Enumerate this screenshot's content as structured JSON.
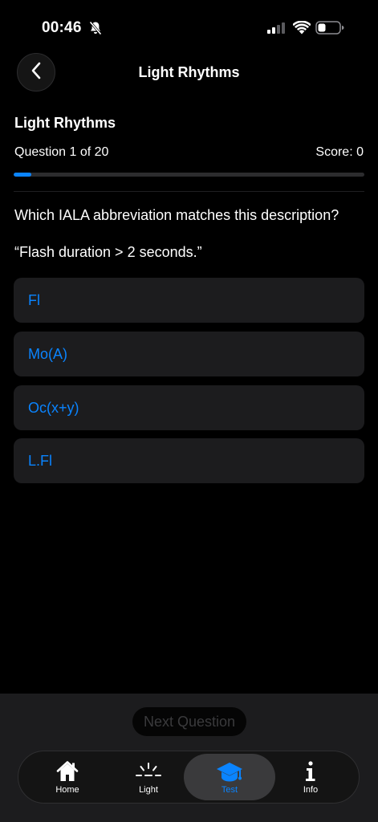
{
  "status": {
    "time": "00:46"
  },
  "nav": {
    "title": "Light Rhythms"
  },
  "quiz": {
    "title": "Light Rhythms",
    "progress_text": "Question 1 of 20",
    "score_text": "Score: 0",
    "progress_fraction": 0.05,
    "question": "Which IALA abbreviation matches this description?",
    "description": "“Flash duration > 2 seconds.”",
    "options": [
      "Fl",
      "Mo(A)",
      "Oc(x+y)",
      "L.Fl"
    ]
  },
  "next_button": {
    "label": "Next Question"
  },
  "tabs": [
    {
      "label": "Home",
      "icon": "house-icon",
      "active": false
    },
    {
      "label": "Light",
      "icon": "light-rays-icon",
      "active": false
    },
    {
      "label": "Test",
      "icon": "graduation-cap-icon",
      "active": true
    },
    {
      "label": "Info",
      "icon": "info-icon",
      "active": false
    }
  ],
  "colors": {
    "accent": "#0a84ff",
    "background": "#000000",
    "card": "#1c1c1e"
  }
}
